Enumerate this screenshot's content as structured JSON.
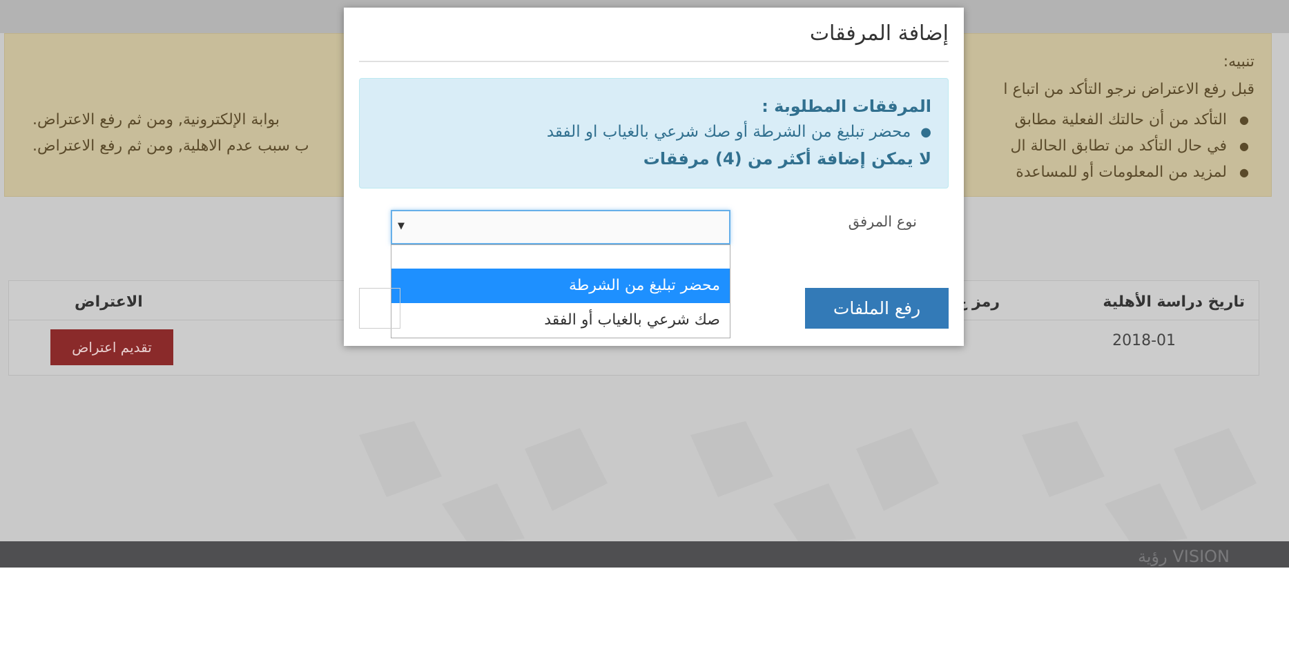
{
  "background": {
    "alert": {
      "title": "تنبيه:",
      "lead": "قبل رفع الاعتراض نرجو التأكد من اتباع ا",
      "items": [
        {
          "text": "التأكد من أن حالتك الفعلية مطابق",
          "cont": "بوابة الإلكترونية, ومن ثم رفع الاعتراض."
        },
        {
          "text": "في حال التأكد من تطابق الحالة ال",
          "cont": "ب سبب عدم الاهلية, ومن ثم رفع الاعتراض."
        },
        {
          "text": "لمزيد من المعلومات أو للمساعدة",
          "cont": ""
        }
      ]
    },
    "table": {
      "headers": [
        "تاريخ دراسة الأهلية",
        "رمز ع",
        "الاعتراض"
      ],
      "row": {
        "date": "2018-01",
        "action": "تقديم اعتراض"
      }
    },
    "footer": {
      "logo": "رؤية VISION"
    }
  },
  "modal": {
    "title": "إضافة المرفقات",
    "info": {
      "required_label": "المرفقات المطلوبة :",
      "item": "محضر تبليغ من الشرطة أو صك شرعي بالغياب او الفقد",
      "limit": "لا يمكن إضافة أكثر من (4) مرفقات"
    },
    "attachment_type_label": "نوع المرفق",
    "select_value": "",
    "options": [
      "",
      "محضر تبليغ من الشرطة",
      "صك شرعي بالغياب أو الفقد"
    ],
    "upload_label": "رفع الملفات"
  },
  "colors": {
    "primary": "#337ab7",
    "highlight": "#1e90ff",
    "danger": "#8a2a2a",
    "info_bg": "#d9edf7"
  }
}
